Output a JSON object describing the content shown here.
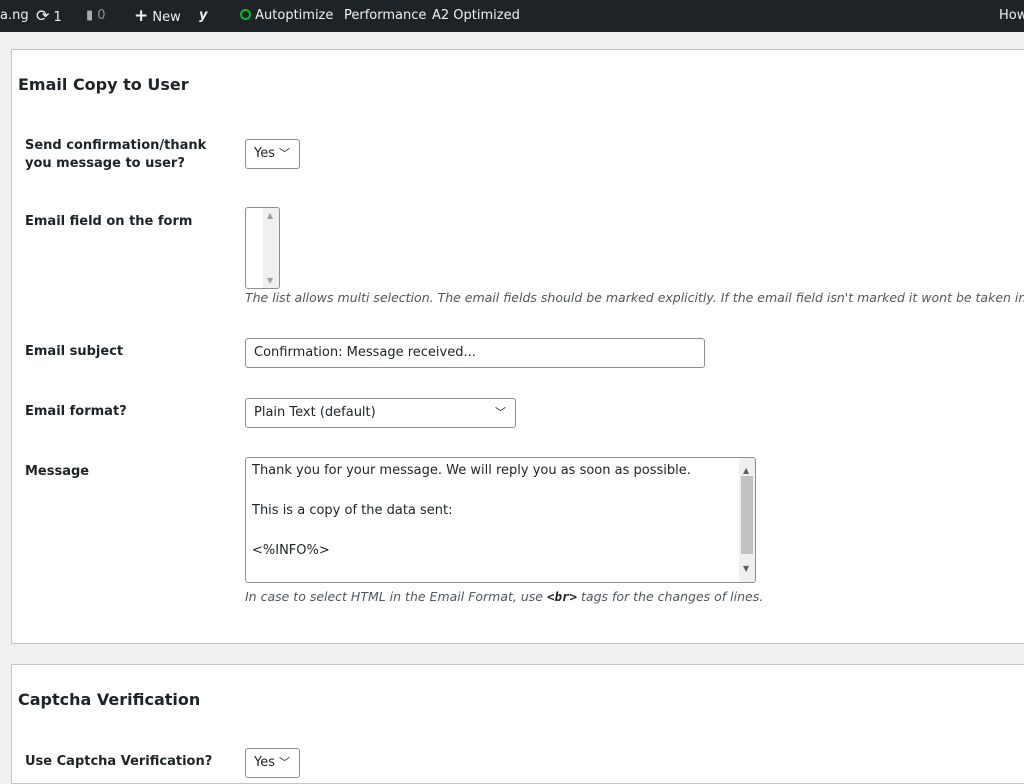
{
  "adminbar": {
    "site": "a.ng",
    "updates": "1",
    "comments": "0",
    "new": "New",
    "autoptimize": "Autoptimize",
    "performance": "Performance",
    "a2": "A2 Optimized",
    "howdy": "How"
  },
  "email_copy": {
    "title": "Email Copy to User",
    "send_label": "Send confirmation/thank you message to user?",
    "send_value": "Yes",
    "field_label": "Email field on the form",
    "field_desc": "The list allows multi selection. The email fields should be marked explicitly. If the email field isn't marked it wont be taken in account",
    "subject_label": "Email subject",
    "subject_value": "Confirmation: Message received...",
    "format_label": "Email format?",
    "format_value": "Plain Text (default)",
    "message_label": "Message",
    "message_lines": [
      "Thank you for your message. We will reply you as soon as possible.",
      "",
      "This is a copy of the data sent:",
      "",
      "<%INFO%>"
    ],
    "message_desc_pre": "In case to select HTML in the Email Format, use ",
    "message_desc_tag": "<br>",
    "message_desc_post": " tags for the changes of lines."
  },
  "captcha": {
    "title": "Captcha Verification",
    "use_label": "Use Captcha Verification?",
    "use_value": "Yes"
  },
  "colors": {
    "adminbar": "#1d2327",
    "status_green": "#00ba37"
  }
}
